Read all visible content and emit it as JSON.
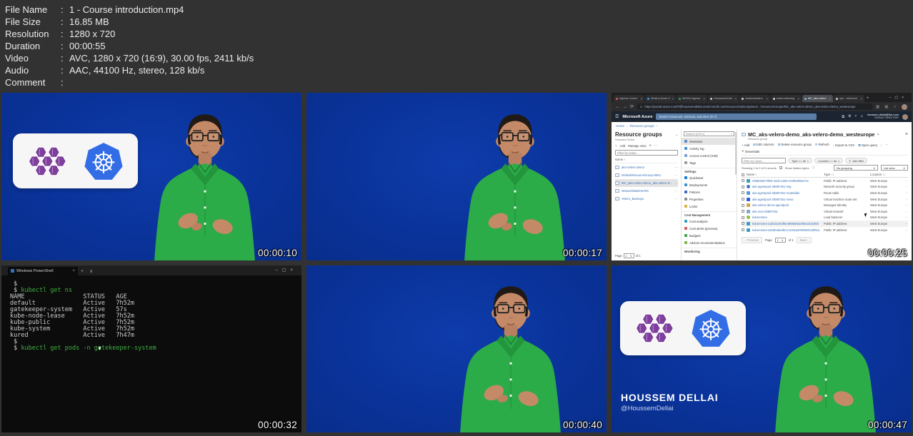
{
  "metadata": {
    "separator": ":",
    "rows": [
      {
        "label": "File Name",
        "value": "1 - Course introduction.mp4"
      },
      {
        "label": "File Size",
        "value": "16.85 MB"
      },
      {
        "label": "Resolution",
        "value": "1280 x 720"
      },
      {
        "label": "Duration",
        "value": "00:00:55"
      },
      {
        "label": "Video",
        "value": "AVC, 1280 x 720 (16:9), 30.00 fps, 2411 kb/s"
      },
      {
        "label": "Audio",
        "value": "AAC, 44100 Hz, stereo, 128 kb/s"
      },
      {
        "label": "Comment",
        "value": ""
      }
    ]
  },
  "icons": {
    "close": "×",
    "minimize": "–",
    "maximize": "▢",
    "add": "+",
    "chevron_down": "∨",
    "sort_up": "↑",
    "sort_both": "↑↓",
    "ellipsis": "⋯",
    "refresh": "⟳",
    "download": "↓",
    "columns": "⊞",
    "delete": "⊟",
    "query": "⧉",
    "edit": "✎",
    "star": "☆",
    "menu": "☰",
    "back": "←",
    "forward": "→",
    "info": "ⓘ",
    "prev": "‹",
    "next": "›",
    "collapse": "«",
    "gear": "⚙",
    "help": "?",
    "smiley": "☺",
    "pin": "⊡",
    "funnel": "▽",
    "lock": "⊙"
  },
  "thumbnails": {
    "t1": {
      "timestamp": "00:00:10"
    },
    "t2": {
      "timestamp": "00:00:17"
    },
    "t3": {
      "timestamp": "00:00:25",
      "browser": {
        "tabs": [
          {
            "label": "Ingress Contro"
          },
          {
            "label": "What is Azure K"
          },
          {
            "label": "AKS04 Ingress"
          },
          {
            "label": "HoussemDellai"
          },
          {
            "label": "charts/stable/n"
          },
          {
            "label": "kubernetes/ing"
          },
          {
            "label": "MC_aks-velero"
          },
          {
            "label": "ops - webhook"
          }
        ],
        "url": "https://portal.azure.com/#@houssemdellai.onmicrosoft.com/resource/subscriptions/.../resourceGroups/MC_aks-velero-demo_aks-velero-demo_westeurope"
      },
      "azure": {
        "topbar": {
          "brand": "Microsoft Azure",
          "search": "Search resources, services, and docs (G+/)",
          "account_line1": "houssem.dellai@live.com",
          "account_line2": "DEFAULT DIRECTORY"
        },
        "breadcrumb": {
          "home": "Home",
          "section": "Resource groups"
        },
        "left": {
          "title": "Resource groups",
          "subtitle": "Houssem Dellai",
          "add": "Add",
          "manage_view": "Manage view",
          "filter": "Filter by name...",
          "name_col": "Name",
          "items": [
            "aks-velero-demo",
            "DefaultResourceGroup-WEU",
            "MC_aks-velero-demo_aks-velero-demo",
            "NetworkWatcherRG",
            "Velero_Backups"
          ],
          "page_label": "Page",
          "page_value": "1",
          "of_label": "of 1"
        },
        "menu": {
          "search": "Search (Ctrl+/)",
          "items": [
            "Overview",
            "Activity log",
            "Access control (IAM)",
            "Tags"
          ],
          "sections": [
            {
              "header": "Settings",
              "items": [
                "Quickstart",
                "Deployments",
                "Policies",
                "Properties",
                "Locks"
              ]
            },
            {
              "header": "Cost Management",
              "items": [
                "Cost analysis",
                "Cost alerts (preview)",
                "Budgets",
                "Advisor recommendations"
              ]
            },
            {
              "header": "Monitoring",
              "items": []
            }
          ]
        },
        "main": {
          "title": "MC_aks-velero-demo_aks-velero-demo_westeurope",
          "subtitle": "Resource group",
          "toolbar": [
            "Add",
            "Edit columns",
            "Delete resource group",
            "Refresh",
            "Export to CSV",
            "Open query"
          ],
          "essentials": "Essentials",
          "filter": "Filter by name...",
          "pill_type": "Type == all",
          "pill_location": "Location == all",
          "pill_add": "Add filter",
          "showing": "Showing 1 to 9 of 9 records",
          "show_hidden": "Show hidden types",
          "grouping": "No grouping",
          "view": "List view",
          "col_name": "Name",
          "col_type": "Type",
          "col_location": "Location",
          "rows": [
            {
              "name": "20950264-f9b0-4ad2-a284-e4394806a71e",
              "type": "Public IP address",
              "location": "West Europe"
            },
            {
              "name": "aks-agentpool-25887451-nsg",
              "type": "Network security group",
              "location": "West Europe"
            },
            {
              "name": "aks-agentpool-25887451-routetable",
              "type": "Route table",
              "location": "West Europe"
            },
            {
              "name": "aks-agentpool-25887451-vmss",
              "type": "Virtual machine scale set",
              "location": "West Europe"
            },
            {
              "name": "aks-velero-demo-agentpool",
              "type": "Managed Identity",
              "location": "West Europe"
            },
            {
              "name": "aks-vnet-25887451",
              "type": "Virtual network",
              "location": "West Europe"
            },
            {
              "name": "kubernetes",
              "type": "Load balancer",
              "location": "West Europe"
            },
            {
              "name": "kubernetes-a30c51e54f6e48956b5448542231950",
              "type": "Public IP address",
              "location": "West Europe"
            },
            {
              "name": "kubernetes-a9c8b4ded9c1c4c92a4000992418f8ca",
              "type": "Public IP address",
              "location": "West Europe"
            }
          ],
          "prev": "Previous",
          "page_label": "Page",
          "page_value": "1",
          "of_label": "of 1",
          "next": "Next"
        }
      }
    },
    "t4": {
      "timestamp": "00:00:32",
      "terminal": {
        "tab_title": "Windows PowerShell",
        "lines": [
          {
            "prompt": " $",
            "cmd": ""
          },
          {
            "prompt": " $",
            "cmd": " kubectl get ns"
          },
          {
            "out": "NAME                STATUS   AGE"
          },
          {
            "out": "default             Active   7h52m"
          },
          {
            "out": "gatekeeper-system   Active   57s"
          },
          {
            "out": "kube-node-lease     Active   7h52m"
          },
          {
            "out": "kube-public         Active   7h52m"
          },
          {
            "out": "kube-system         Active   7h52m"
          },
          {
            "out": "kured               Active   7h47m"
          },
          {
            "prompt": " $",
            "cmd": ""
          },
          {
            "prompt": " $",
            "cmd": " kubectl get pods -n gatekeeper-system"
          }
        ]
      }
    },
    "t5": {
      "timestamp": "00:00:40"
    },
    "t6": {
      "timestamp": "00:00:47",
      "name": "HOUSSEM DELLAI",
      "handle": "@HoussemDellai"
    }
  }
}
